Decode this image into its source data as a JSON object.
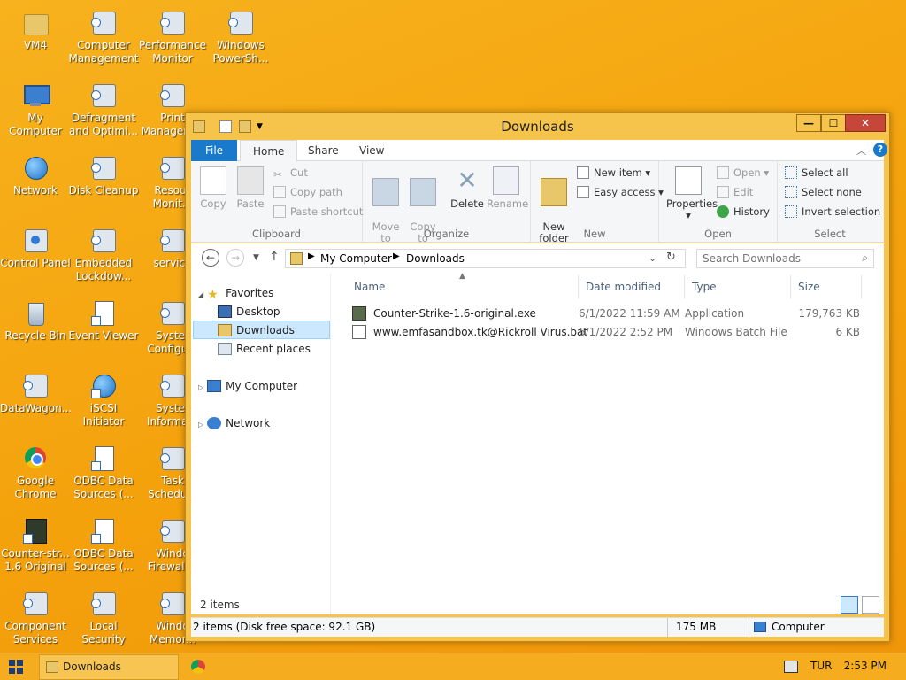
{
  "desktop_icons": [
    {
      "label": "VM4",
      "icon": "folder-icon"
    },
    {
      "label": "Computer\nManagement",
      "icon": "computer-management-icon"
    },
    {
      "label": "Performance\nMonitor",
      "icon": "performance-monitor-icon"
    },
    {
      "label": "Windows\nPowerSh...",
      "icon": "powershell-icon"
    },
    {
      "label": "My Computer",
      "icon": "computer-icon"
    },
    {
      "label": "Defragment\nand Optimi...",
      "icon": "defragment-icon"
    },
    {
      "label": "Print\nManagem...",
      "icon": "print-management-icon"
    },
    {
      "label": "Network",
      "icon": "network-icon"
    },
    {
      "label": "Disk Cleanup",
      "icon": "disk-cleanup-icon"
    },
    {
      "label": "Resour\nMonit...",
      "icon": "resource-monitor-icon"
    },
    {
      "label": "Control Panel",
      "icon": "control-panel-icon"
    },
    {
      "label": "Embedded\nLockdow...",
      "icon": "embedded-lockdown-icon"
    },
    {
      "label": "service",
      "icon": "services-icon"
    },
    {
      "label": "Recycle Bin",
      "icon": "recycle-bin-icon"
    },
    {
      "label": "Event Viewer",
      "icon": "event-viewer-icon"
    },
    {
      "label": "Syster\nConfigu...",
      "icon": "system-configuration-icon"
    },
    {
      "label": "DataWagon...",
      "icon": "datawagon-icon"
    },
    {
      "label": "iSCSI Initiator",
      "icon": "iscsi-initiator-icon"
    },
    {
      "label": "Syster\nInforma...",
      "icon": "system-information-icon"
    },
    {
      "label": "Google\nChrome",
      "icon": "chrome-icon"
    },
    {
      "label": "ODBC Data\nSources (...",
      "icon": "odbc-icon"
    },
    {
      "label": "Task\nSchedu...",
      "icon": "task-scheduler-icon"
    },
    {
      "label": "Counter-str...\n1.6 Original",
      "icon": "counter-strike-icon"
    },
    {
      "label": "ODBC Data\nSources (...",
      "icon": "odbc-icon"
    },
    {
      "label": "Windo\nFirewall...",
      "icon": "firewall-icon"
    },
    {
      "label": "Component\nServices",
      "icon": "component-services-icon"
    },
    {
      "label": "Local Security\nPolicy",
      "icon": "local-security-policy-icon"
    },
    {
      "label": "Windo\nMemor...",
      "icon": "memory-diagnostic-icon"
    }
  ],
  "window": {
    "title": "Downloads",
    "minimize": "—",
    "maximize": "☐",
    "close": "✕",
    "help": "?"
  },
  "tabs": {
    "file": "File",
    "home": "Home",
    "share": "Share",
    "view": "View"
  },
  "ribbon": {
    "clipboard": {
      "title": "Clipboard",
      "copy": "Copy",
      "paste": "Paste",
      "cut": "Cut",
      "copy_path": "Copy path",
      "paste_shortcut": "Paste shortcut"
    },
    "organize": {
      "title": "Organize",
      "move_to": "Move\nto",
      "copy_to": "Copy\nto",
      "delete": "Delete",
      "rename": "Rename"
    },
    "new": {
      "title": "New",
      "new_folder": "New\nfolder",
      "new_item": "New item",
      "easy_access": "Easy access"
    },
    "open": {
      "title": "Open",
      "properties": "Properties",
      "open": "Open",
      "edit": "Edit",
      "history": "History"
    },
    "select": {
      "title": "Select",
      "select_all": "Select all",
      "select_none": "Select none",
      "invert_selection": "Invert selection"
    }
  },
  "address": {
    "crumbs": [
      "My Computer",
      "Downloads"
    ],
    "search_placeholder": "Search Downloads"
  },
  "nav": {
    "favorites": "Favorites",
    "desktop": "Desktop",
    "downloads": "Downloads",
    "recent_places": "Recent places",
    "my_computer": "My Computer",
    "network": "Network"
  },
  "columns": {
    "name": "Name",
    "date": "Date modified",
    "type": "Type",
    "size": "Size"
  },
  "files": [
    {
      "name": "Counter-Strike-1.6-original.exe",
      "date": "6/1/2022 11:59 AM",
      "type": "Application",
      "size": "179,763 KB"
    },
    {
      "name": "www.emfasandbox.tk@Rickroll Virus.bat",
      "date": "6/1/2022 2:52 PM",
      "type": "Windows Batch File",
      "size": "6 KB"
    }
  ],
  "status": {
    "items_count": "2 items",
    "details": "2 items (Disk free space: 92.1 GB)",
    "size": "175 MB",
    "location": "Computer"
  },
  "taskbar": {
    "app": "Downloads",
    "lang": "TUR",
    "time": "2:53 PM"
  },
  "colors": {
    "accent": "#1979ca",
    "desktop": "#f5a70f",
    "selection": "#cce8ff"
  }
}
